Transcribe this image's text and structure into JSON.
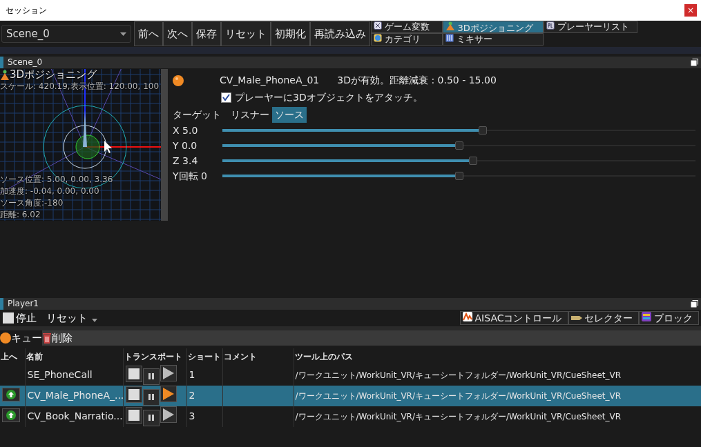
{
  "window": {
    "title": "セッション",
    "close": "×"
  },
  "toolbar": {
    "scene": "Scene_0",
    "buttons": [
      "前へ",
      "次へ",
      "保存",
      "リセット",
      "初期化",
      "再読み込み"
    ]
  },
  "view_tabs": [
    {
      "label": "ゲーム変数",
      "selected": false
    },
    {
      "label": "3Dポジショニング",
      "selected": true
    },
    {
      "label": "プレーヤーリスト",
      "selected": false
    },
    {
      "label": "カテゴリ",
      "selected": false
    },
    {
      "label": "ミキサー",
      "selected": false
    }
  ],
  "scene_panel": {
    "title": "Scene_0",
    "view": {
      "title": "3Dポジショニング",
      "scale_text": "スケール: 420.19,表示位置: 120.00, 100",
      "info": [
        "ソース位置: 5.00, 0.00, 3.36",
        "加速度: -0.04, 0.00, 0.00",
        "ソース角度:-180",
        "距離: 6.02"
      ]
    },
    "cue_name": "CV_Male_PhoneA_01",
    "status": "3Dが有効。距離減衰 : 0.50 - 15.00",
    "attach": {
      "label": "プレーヤーに3Dオブジェクトをアタッチ。",
      "checked": true
    },
    "target": {
      "label": "ターゲット",
      "options": [
        {
          "label": "リスナー",
          "selected": false
        },
        {
          "label": "ソース",
          "selected": true
        }
      ]
    },
    "sliders": [
      {
        "label": "X 5.0",
        "level": 0.55
      },
      {
        "label": "Y 0.0",
        "level": 0.5
      },
      {
        "label": "Z 3.4",
        "level": 0.53
      },
      {
        "label": "Y回転 0",
        "level": 0.5
      }
    ]
  },
  "player_panel": {
    "title": "Player1",
    "stop": "停止",
    "reset": "リセット",
    "tabs": [
      "AISACコントロール",
      "セレクター",
      "ブロック"
    ],
    "cue_tab": "キュー",
    "delete": "削除",
    "table": {
      "columns": [
        "上へ",
        "名前",
        "トランスポート",
        "ショート",
        "コメント",
        "ツール上のパス"
      ],
      "rows": [
        {
          "up": false,
          "name": "SE_PhoneCall",
          "playing": false,
          "short": "1",
          "path": "/ワークユニット/WorkUnit_VR/キューシートフォルダー/WorkUnit_VR/CueSheet_VR",
          "selected": false
        },
        {
          "up": true,
          "name": "CV_Male_PhoneA_...",
          "playing": true,
          "short": "2",
          "path": "/ワークユニット/WorkUnit_VR/キューシートフォルダー/WorkUnit_VR/CueSheet_VR",
          "selected": true
        },
        {
          "up": true,
          "name": "CV_Book_Narratio...",
          "playing": false,
          "short": "3",
          "path": "/ワークユニット/WorkUnit_VR/キューシートフォルダー/WorkUnit_VR/CueSheet_VR",
          "selected": false
        }
      ]
    }
  }
}
